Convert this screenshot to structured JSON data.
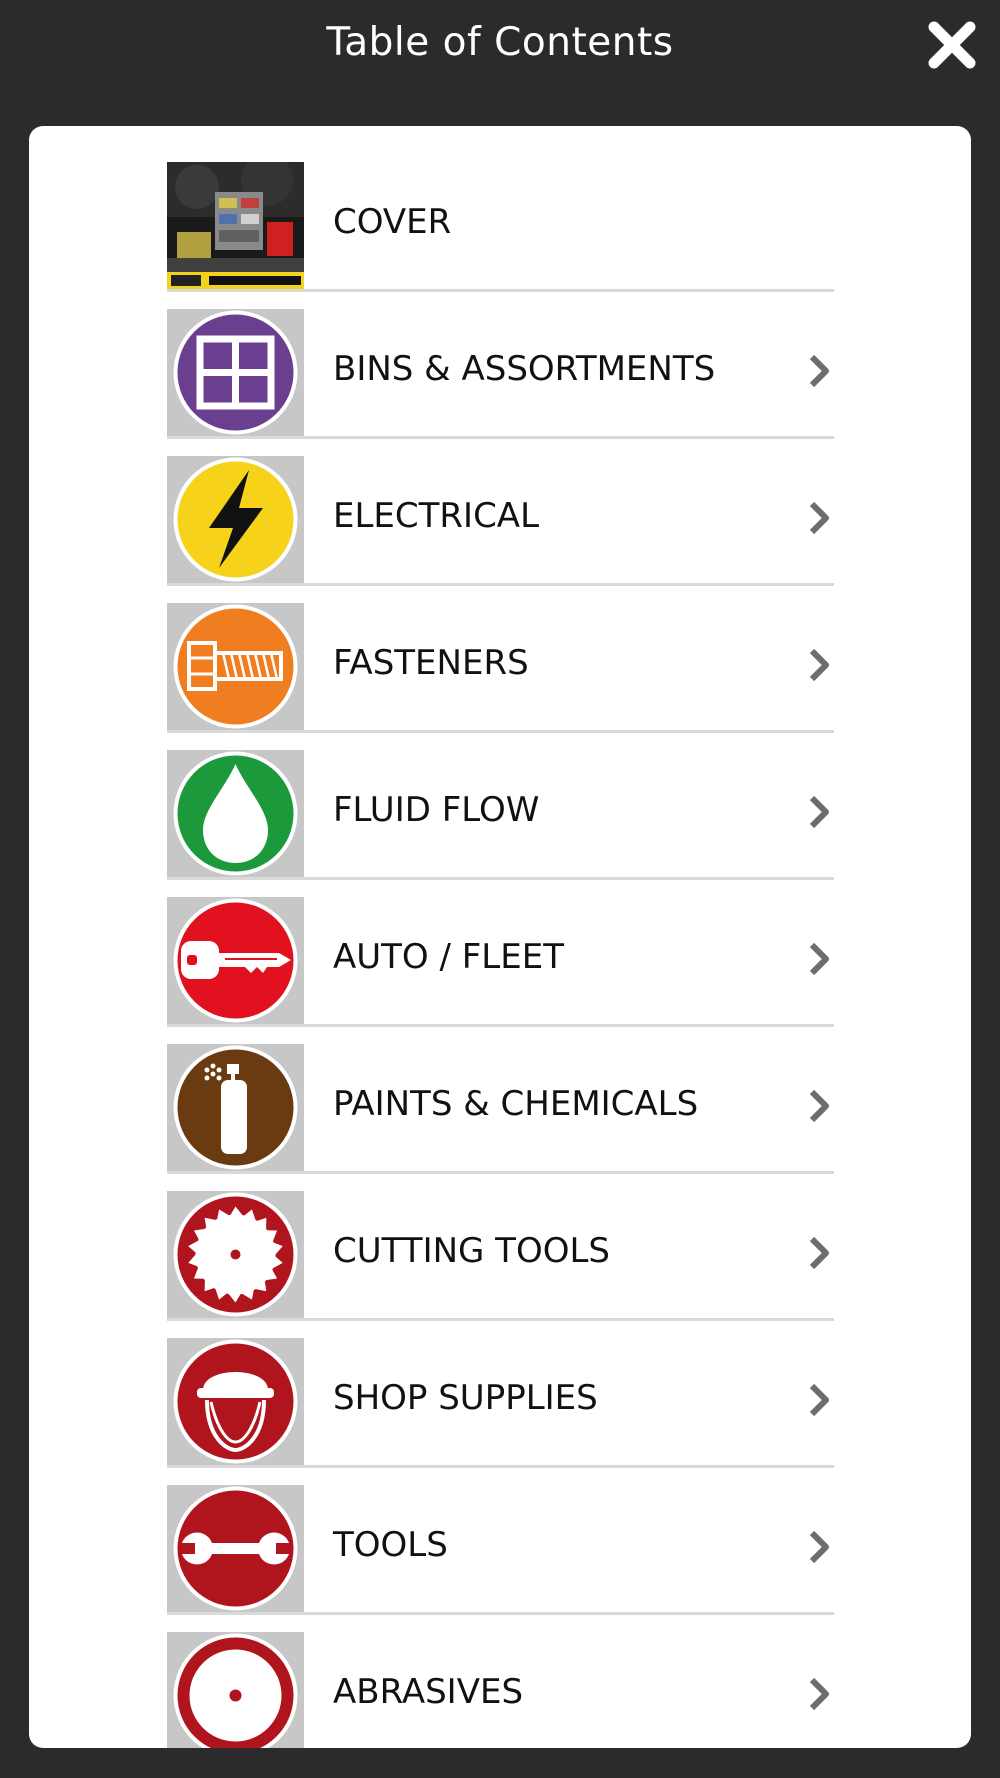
{
  "header": {
    "title": "Table of Contents",
    "close_icon": "close-icon"
  },
  "colors": {
    "background": "#2b2b2b",
    "panel": "#ffffff",
    "divider": "#d9d9d9",
    "thumb_bg": "#c7c7c7"
  },
  "toc": {
    "items": [
      {
        "label": "COVER",
        "icon": "cover-thumbnail",
        "has_chevron": false
      },
      {
        "label": "BINS & ASSORTMENTS",
        "icon": "bins-icon",
        "color": "#6b3f8f",
        "has_chevron": true
      },
      {
        "label": "ELECTRICAL",
        "icon": "lightning-bolt-icon",
        "color": "#f7d21b",
        "has_chevron": true
      },
      {
        "label": "FASTENERS",
        "icon": "bolt-icon",
        "color": "#f07d1f",
        "has_chevron": true
      },
      {
        "label": "FLUID FLOW",
        "icon": "droplet-icon",
        "color": "#1c9a3b",
        "has_chevron": true
      },
      {
        "label": "AUTO / FLEET",
        "icon": "key-icon",
        "color": "#e1111f",
        "has_chevron": true
      },
      {
        "label": "PAINTS & CHEMICALS",
        "icon": "spray-can-icon",
        "color": "#6a3a10",
        "has_chevron": true
      },
      {
        "label": "CUTTING TOOLS",
        "icon": "saw-blade-icon",
        "color": "#b0141c",
        "has_chevron": true
      },
      {
        "label": "SHOP SUPPLIES",
        "icon": "hard-hat-icon",
        "color": "#b0141c",
        "has_chevron": true
      },
      {
        "label": "TOOLS",
        "icon": "wrench-icon",
        "color": "#b0141c",
        "has_chevron": true
      },
      {
        "label": "ABRASIVES",
        "icon": "abrasive-disc-icon",
        "color": "#b0141c",
        "has_chevron": true
      }
    ]
  }
}
